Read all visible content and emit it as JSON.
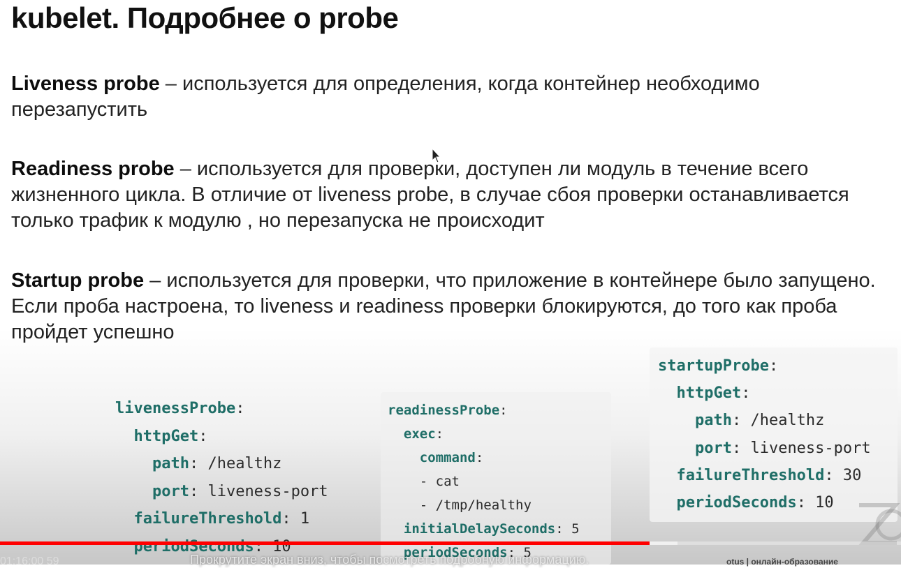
{
  "slide": {
    "title": "kubelet. Подробнее о probe",
    "paragraphs": [
      {
        "term": "Liveness probe",
        "text": " – используется для определения, когда контейнер необходимо перезапустить"
      },
      {
        "term": "Readiness probe",
        "text": " – используется для проверки, доступен ли модуль в течение всего жизненного цикла. В отличие от liveness probe, в случае сбоя проверки останавливается только трафик к модулю , но перезапуска не происходит"
      },
      {
        "term": "Startup probe",
        "text": " – используется для проверки, что приложение в контейнере было запущено. Если проба настроена, то liveness и readiness проверки блокируются, до того как проба пройдет успешно"
      }
    ],
    "code": {
      "liveness": [
        {
          "indent": "",
          "key": "livenessProbe",
          "sep": ":",
          "val": ""
        },
        {
          "indent": "  ",
          "key": "httpGet",
          "sep": ":",
          "val": ""
        },
        {
          "indent": "    ",
          "key": "path",
          "sep": ": ",
          "val": "/healthz"
        },
        {
          "indent": "    ",
          "key": "port",
          "sep": ": ",
          "val": "liveness-port"
        },
        {
          "indent": "  ",
          "key": "failureThreshold",
          "sep": ": ",
          "val": "1"
        },
        {
          "indent": "  ",
          "key": "periodSeconds",
          "sep": ": ",
          "val": "10"
        }
      ],
      "readiness": [
        {
          "indent": "",
          "key": "readinessProbe",
          "sep": ":",
          "val": ""
        },
        {
          "indent": "  ",
          "key": "exec",
          "sep": ":",
          "val": ""
        },
        {
          "indent": "    ",
          "key": "command",
          "sep": ":",
          "val": ""
        },
        {
          "indent": "    ",
          "key": "",
          "sep": "",
          "val": "- cat"
        },
        {
          "indent": "    ",
          "key": "",
          "sep": "",
          "val": "- /tmp/healthy"
        },
        {
          "indent": "  ",
          "key": "initialDelaySeconds",
          "sep": ": ",
          "val": "5"
        },
        {
          "indent": "  ",
          "key": "periodSeconds",
          "sep": ": ",
          "val": "5"
        }
      ],
      "startup": [
        {
          "indent": "",
          "key": "startupProbe",
          "sep": ":",
          "val": ""
        },
        {
          "indent": "  ",
          "key": "httpGet",
          "sep": ":",
          "val": ""
        },
        {
          "indent": "    ",
          "key": "path",
          "sep": ": ",
          "val": "/healthz"
        },
        {
          "indent": "    ",
          "key": "port",
          "sep": ": ",
          "val": "liveness-port"
        },
        {
          "indent": "  ",
          "key": "failureThreshold",
          "sep": ": ",
          "val": "30"
        },
        {
          "indent": "  ",
          "key": "periodSeconds",
          "sep": ": ",
          "val": "10"
        }
      ]
    }
  },
  "player": {
    "played_fraction": 0.721,
    "buffered_fraction": 0.752,
    "time": "01:16:00 59",
    "hint": "Прокрутите экран вниз, чтобы посмотреть подробную информацию.",
    "brand": "otus | онлайн-образование"
  },
  "colors": {
    "progress": "#ff0000",
    "code_key": "#1f6e67"
  }
}
